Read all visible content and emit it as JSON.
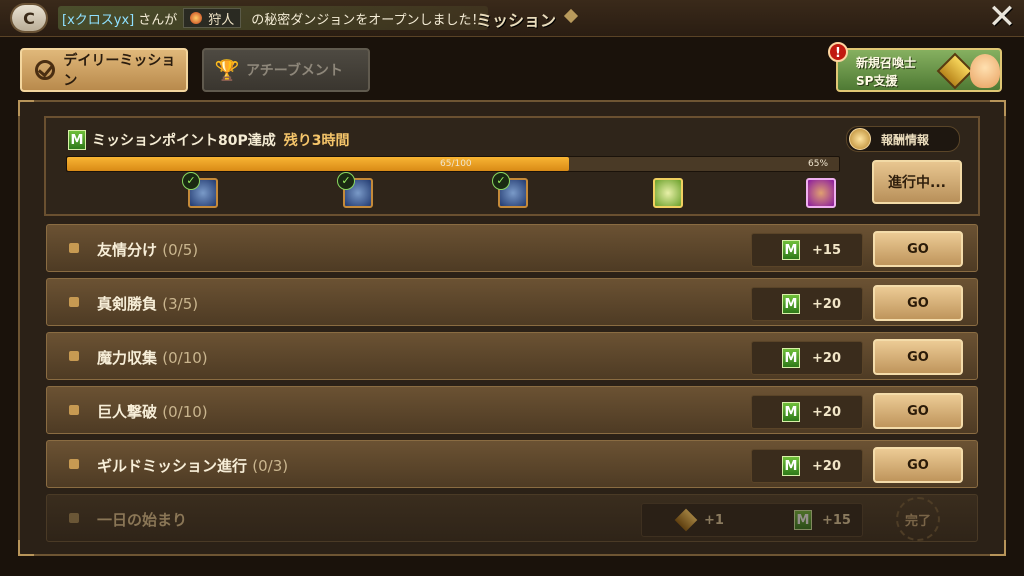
{
  "topbar": {
    "chat_icon": "C",
    "notice_user": "[xクロスyx]",
    "notice_text1": "さんが",
    "notice_dungeon": "狩人",
    "notice_text2": "の秘密ダンジョンをオープンしました！",
    "title": "ミッション",
    "close_icon": "✕"
  },
  "tabs": {
    "daily": "デイリーミッション",
    "achievement": "アチーブメント"
  },
  "promo": {
    "line1": "新規召喚士",
    "line2": "SP支援",
    "badge": "!"
  },
  "points": {
    "m_icon": "M",
    "title": "ミッションポイント80P達成",
    "remaining": "残り3時間",
    "reward_info": "報酬情報",
    "progress_label": "65/100",
    "progress_pct": "65%",
    "progress_value": 0.65,
    "progress_button": "進行中...",
    "check": "✓",
    "rewards": [
      {
        "completed": true
      },
      {
        "completed": true
      },
      {
        "completed": true
      },
      {
        "completed": false
      },
      {
        "completed": false
      }
    ]
  },
  "missions": [
    {
      "name": "友情分け",
      "progress": "(0/5)",
      "points": "+15",
      "button": "GO"
    },
    {
      "name": "真剣勝負",
      "progress": "(3/5)",
      "points": "+20",
      "button": "GO"
    },
    {
      "name": "魔力収集",
      "progress": "(0/10)",
      "points": "+20",
      "button": "GO"
    },
    {
      "name": "巨人撃破",
      "progress": "(0/10)",
      "points": "+20",
      "button": "GO"
    },
    {
      "name": "ギルドミッション進行",
      "progress": "(0/3)",
      "points": "+20",
      "button": "GO"
    }
  ],
  "completed_mission": {
    "name": "一日の始まり",
    "gem_points": "+1",
    "points": "+15",
    "status": "完了"
  }
}
